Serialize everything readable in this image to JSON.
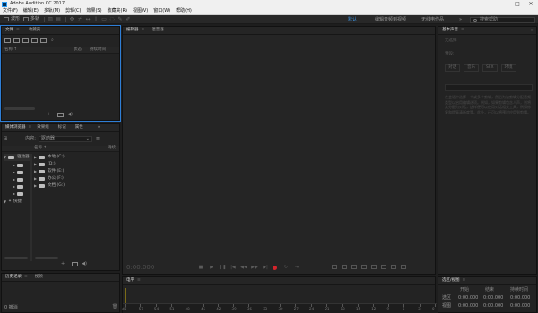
{
  "window": {
    "title": "Adobe Audition CC 2017",
    "controls": [
      "—",
      "□",
      "✕"
    ]
  },
  "menu": [
    "文件(F)",
    "编辑(E)",
    "多轨(M)",
    "剪辑(C)",
    "效果(S)",
    "收藏夹(R)",
    "视图(V)",
    "窗口(W)",
    "帮助(H)"
  ],
  "toolbar": {
    "waveform": "波形",
    "multitrack": "多轨"
  },
  "workspaces": {
    "default": "默认",
    "edit_audio_video": "编辑音频到视频",
    "radio": "无线电作品",
    "more": "»"
  },
  "search": {
    "placeholder": "搜索帮助"
  },
  "files_panel": {
    "tabs": [
      "文件",
      "收藏夹"
    ],
    "columns": {
      "name": "名称 ↑",
      "status": "状态",
      "duration": "持续时间"
    }
  },
  "media_browser": {
    "tabs": [
      "媒体浏览器",
      "效果组",
      "标记",
      "属性"
    ],
    "content_label": "内容:",
    "content_value": "驱动器",
    "columns": {
      "name": "名称 ↑",
      "duration": "持续"
    },
    "root": "驱动器",
    "drives": [
      "本地 (C:)",
      "(D:)",
      "软件 (E:)",
      "办公 (F:)",
      "文档 (G:)"
    ],
    "shortcuts": "快捷"
  },
  "history_panel": {
    "tabs": [
      "历史记录",
      "视频"
    ],
    "undo": "0 撤消"
  },
  "editor": {
    "tabs": [
      "编辑器",
      "混音器"
    ],
    "timecode": "0:00.000"
  },
  "levels_panel": {
    "title": "电平",
    "scale": [
      "dB",
      "-57",
      "-54",
      "-51",
      "-48",
      "-45",
      "-42",
      "-39",
      "-36",
      "-33",
      "-30",
      "-27",
      "-24",
      "-21",
      "-18",
      "-15",
      "-12",
      "-9",
      "-6",
      "-3",
      "0"
    ]
  },
  "essential_sound": {
    "title": "基本声音",
    "no_selection": "无选择",
    "preset_label": "预设:",
    "assign_label": "将音频类型分配给",
    "types": [
      "对话",
      "音乐",
      "SFX",
      "环境"
    ],
    "description": "在会话中选择一个或多个剪辑，然后为该剪辑分配音频类型以启用编辑选项。例如，如果剪辑包含人声，则将其分配为对话，这样便可以使用对话相关工具，例如修复和提高清晰度等。此外，还可以将预设应用到剪辑。"
  },
  "selection_panel": {
    "title": "选区/视图",
    "columns": [
      "开始",
      "结束",
      "持续时间"
    ],
    "rows": [
      {
        "label": "选区",
        "start": "0:00.000",
        "end": "0:00.000",
        "duration": "0:00.000"
      },
      {
        "label": "视图",
        "start": "0:00.000",
        "end": "0:00.000",
        "duration": "0:00.000"
      }
    ]
  }
}
